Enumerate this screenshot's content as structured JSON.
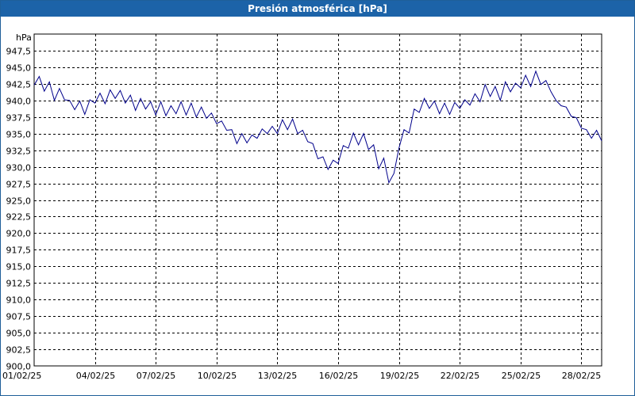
{
  "window": {
    "title": "Presión atmosférica [hPa]"
  },
  "chart_data": {
    "type": "line",
    "title": "Presión atmosférica [hPa]",
    "ylabel": "hPa",
    "xlabel": "",
    "ylim": [
      900.0,
      950.0
    ],
    "xlim": [
      "2025-02-01",
      "2025-03-01"
    ],
    "grid": true,
    "legend": "none",
    "line_color": "#00008b",
    "y_ticks": [
      "900,0",
      "902,5",
      "905,0",
      "907,5",
      "910,0",
      "912,5",
      "915,0",
      "917,5",
      "920,0",
      "922,5",
      "925,0",
      "927,5",
      "930,0",
      "932,5",
      "935,0",
      "937,5",
      "940,0",
      "942,5",
      "945,0",
      "947,5"
    ],
    "x_ticks": [
      "01/02/25",
      "04/02/25",
      "07/02/25",
      "10/02/25",
      "13/02/25",
      "16/02/25",
      "19/02/25",
      "22/02/25",
      "25/02/25",
      "28/02/25"
    ],
    "series": [
      {
        "x": [
          "2025-02-01 00:00",
          "2025-02-01 06:00",
          "2025-02-01 12:00",
          "2025-02-01 18:00",
          "2025-02-02 00:00",
          "2025-02-02 06:00",
          "2025-02-02 12:00",
          "2025-02-02 18:00",
          "2025-02-03 00:00",
          "2025-02-03 06:00",
          "2025-02-03 12:00",
          "2025-02-03 18:00",
          "2025-02-04 00:00",
          "2025-02-04 06:00",
          "2025-02-04 12:00",
          "2025-02-04 18:00",
          "2025-02-05 00:00",
          "2025-02-05 06:00",
          "2025-02-05 12:00",
          "2025-02-05 18:00",
          "2025-02-06 00:00",
          "2025-02-06 06:00",
          "2025-02-06 12:00",
          "2025-02-06 18:00",
          "2025-02-07 00:00",
          "2025-02-07 06:00",
          "2025-02-07 12:00",
          "2025-02-07 18:00",
          "2025-02-08 00:00",
          "2025-02-08 06:00",
          "2025-02-08 12:00",
          "2025-02-08 18:00",
          "2025-02-09 00:00",
          "2025-02-09 06:00",
          "2025-02-09 12:00",
          "2025-02-09 18:00",
          "2025-02-10 00:00",
          "2025-02-10 06:00",
          "2025-02-10 12:00",
          "2025-02-10 18:00",
          "2025-02-11 00:00",
          "2025-02-11 06:00",
          "2025-02-11 12:00",
          "2025-02-11 18:00",
          "2025-02-12 00:00",
          "2025-02-12 06:00",
          "2025-02-12 12:00",
          "2025-02-12 18:00",
          "2025-02-13 00:00",
          "2025-02-13 06:00",
          "2025-02-13 12:00",
          "2025-02-13 18:00",
          "2025-02-14 00:00",
          "2025-02-14 06:00",
          "2025-02-14 12:00",
          "2025-02-14 18:00",
          "2025-02-15 00:00",
          "2025-02-15 06:00",
          "2025-02-15 12:00",
          "2025-02-15 18:00",
          "2025-02-16 00:00",
          "2025-02-16 06:00",
          "2025-02-16 12:00",
          "2025-02-16 18:00",
          "2025-02-17 00:00",
          "2025-02-17 06:00",
          "2025-02-17 12:00",
          "2025-02-17 18:00",
          "2025-02-18 00:00",
          "2025-02-18 06:00",
          "2025-02-18 12:00",
          "2025-02-18 18:00",
          "2025-02-19 00:00",
          "2025-02-19 06:00",
          "2025-02-19 12:00",
          "2025-02-19 18:00",
          "2025-02-20 00:00",
          "2025-02-20 06:00",
          "2025-02-20 12:00",
          "2025-02-20 18:00",
          "2025-02-21 00:00",
          "2025-02-21 06:00",
          "2025-02-21 12:00",
          "2025-02-21 18:00",
          "2025-02-22 00:00",
          "2025-02-22 06:00",
          "2025-02-22 12:00",
          "2025-02-22 18:00",
          "2025-02-23 00:00",
          "2025-02-23 06:00",
          "2025-02-23 12:00",
          "2025-02-23 18:00",
          "2025-02-24 00:00",
          "2025-02-24 06:00",
          "2025-02-24 12:00",
          "2025-02-24 18:00",
          "2025-02-25 00:00",
          "2025-02-25 06:00",
          "2025-02-25 12:00",
          "2025-02-25 18:00",
          "2025-02-26 00:00",
          "2025-02-26 06:00",
          "2025-02-26 12:00",
          "2025-02-26 18:00",
          "2025-02-27 00:00",
          "2025-02-27 06:00",
          "2025-02-27 12:00",
          "2025-02-27 18:00",
          "2025-02-28 00:00",
          "2025-02-28 06:00",
          "2025-02-28 12:00",
          "2025-02-28 18:00",
          "2025-03-01 00:00"
        ],
        "values": [
          942.3,
          943.6,
          941.4,
          942.8,
          940.0,
          941.8,
          940.1,
          940.0,
          938.6,
          939.9,
          937.9,
          940.1,
          939.6,
          941.1,
          939.5,
          941.6,
          940.3,
          941.5,
          939.6,
          940.8,
          938.5,
          940.3,
          938.7,
          939.8,
          937.8,
          939.8,
          937.7,
          939.2,
          938.0,
          939.8,
          937.8,
          939.6,
          937.5,
          939.0,
          937.3,
          938.1,
          936.5,
          936.9,
          935.5,
          935.6,
          933.5,
          935.0,
          933.6,
          934.8,
          934.3,
          935.7,
          935.0,
          936.1,
          935.0,
          937.1,
          935.6,
          937.2,
          935.0,
          935.5,
          933.8,
          933.5,
          931.2,
          931.5,
          929.6,
          931.0,
          930.5,
          933.2,
          932.8,
          935.1,
          933.3,
          935.0,
          932.6,
          933.3,
          929.7,
          931.3,
          927.6,
          929.0,
          932.8,
          935.6,
          935.1,
          938.7,
          938.2,
          940.3,
          938.8,
          939.9,
          938.0,
          939.6,
          937.9,
          939.7,
          938.8,
          940.1,
          939.3,
          941.0,
          939.8,
          942.4,
          940.6,
          942.1,
          940.0,
          942.8,
          941.3,
          942.6,
          941.9,
          943.8,
          942.1,
          944.4,
          942.4,
          943.0,
          941.3,
          940.0,
          939.2,
          939.0,
          937.6,
          937.4,
          935.8,
          935.6,
          934.3,
          935.5,
          933.9
        ]
      }
    ]
  }
}
